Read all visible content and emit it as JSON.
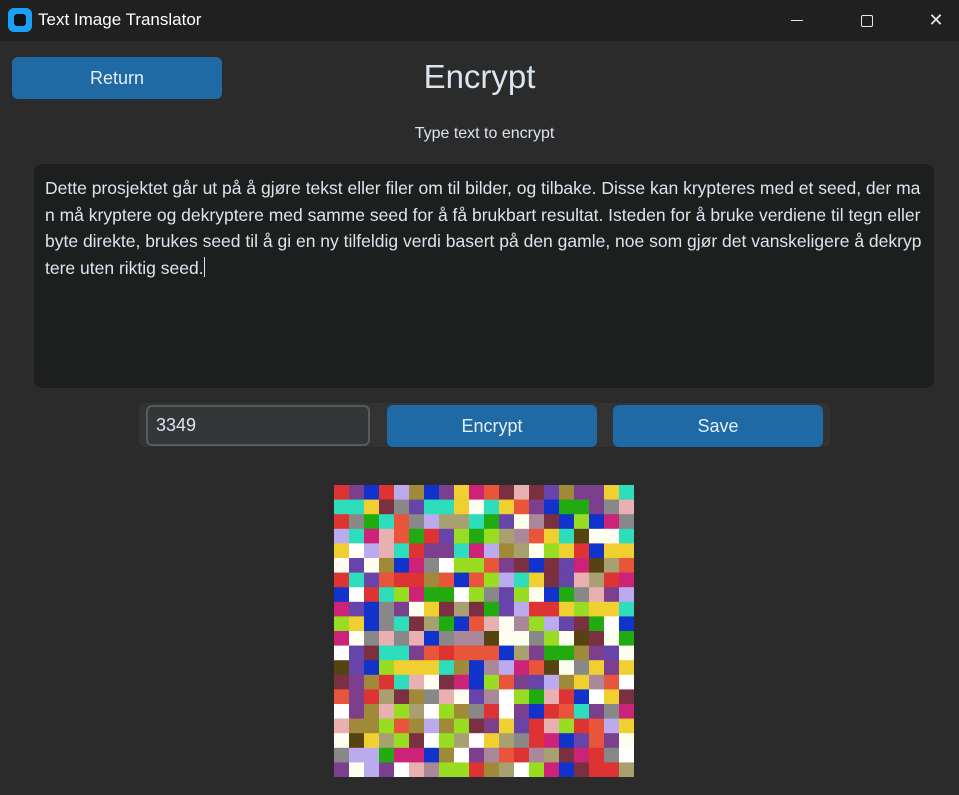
{
  "window": {
    "title": "Text Image Translator",
    "icon": "app-icon",
    "controls": [
      "minimize-icon",
      "maximize-icon",
      "close-icon"
    ]
  },
  "header": {
    "return_label": "Return",
    "title": "Encrypt",
    "subtitle": "Type text to encrypt"
  },
  "editor": {
    "text": "Dette prosjektet går ut på å gjøre tekst eller filer om til bilder, og tilbake. Disse kan krypteres med et seed, der man må kryptere og dekryptere med samme seed for å få brukbart resultat. Isteden for å bruke verdiene til tegn eller byte direkte, brukes seed til å gi en ny tilfeldig verdi basert på den gamle, noe som gjør det vanskeligere å dekryptere uten riktig seed."
  },
  "controls": {
    "seed_value": "3349",
    "encrypt_label": "Encrypt",
    "save_label": "Save"
  },
  "colors": {
    "background": "#2b2b2b",
    "titlebar": "#202020",
    "accent_button": "#1f6aa5",
    "textbox": "#1d1e1e",
    "input": "#343638"
  },
  "output_image": {
    "description_icon": "encrypted-pixel-image",
    "columns": 20,
    "rows": 20,
    "palette": [
      "#ffffff",
      "#fdfdf0",
      "#7b3f8e",
      "#a08a3a",
      "#e8553a",
      "#1133cc",
      "#888888",
      "#2eddbb",
      "#cc2277",
      "#99dd22",
      "#bbaaee",
      "#554411",
      "#e8b0b0",
      "#22aa11",
      "#f0d030",
      "#a8a070",
      "#aa8899",
      "#6644aa",
      "#dd3333",
      "#7a3040"
    ]
  }
}
